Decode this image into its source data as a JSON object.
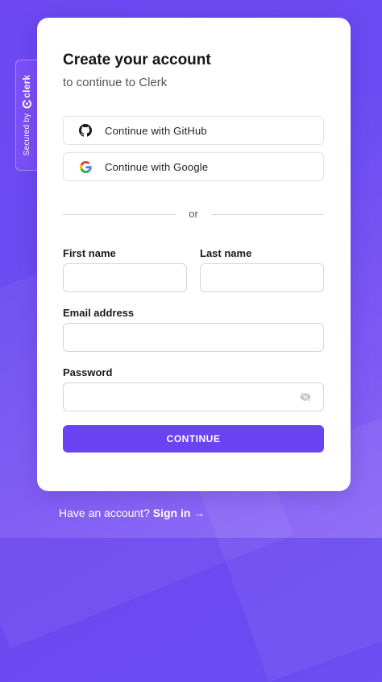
{
  "badge": {
    "secured_by": "Secured by",
    "brand": "clerk"
  },
  "card": {
    "title": "Create your account",
    "subtitle": "to continue to Clerk"
  },
  "social": {
    "github_label": "Continue with GitHub",
    "google_label": "Continue with Google",
    "github_icon": "github-icon",
    "google_icon": "google-icon"
  },
  "divider": {
    "text": "or"
  },
  "form": {
    "first_name": {
      "label": "First name",
      "value": "",
      "placeholder": ""
    },
    "last_name": {
      "label": "Last name",
      "value": "",
      "placeholder": ""
    },
    "email": {
      "label": "Email address",
      "value": "",
      "placeholder": ""
    },
    "password": {
      "label": "Password",
      "value": "",
      "placeholder": "",
      "toggle_icon": "eye-off-icon"
    },
    "submit_label": "CONTINUE"
  },
  "footer": {
    "prompt": "Have an account?",
    "link": "Sign in →"
  },
  "colors": {
    "accent": "#6a44f3",
    "background": "#6c47f0"
  }
}
